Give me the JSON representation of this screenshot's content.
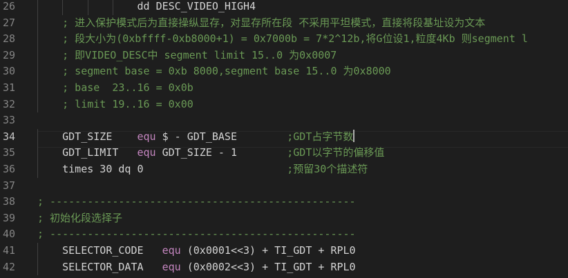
{
  "lines": [
    {
      "num": "26",
      "code": [
        {
          "t": "                dd DESC_VIDEO_HIGH4",
          "c": "plain"
        }
      ]
    },
    {
      "num": "27",
      "code": [
        {
          "t": "    ; 进入保护模式后为直接操纵显存，对显存所在段 不采用平坦模式，直接将段基址设为文本",
          "c": "cm"
        }
      ]
    },
    {
      "num": "28",
      "code": [
        {
          "t": "    ; 段大小为(0xbffff-0xb8000+1) = 0x7000b = 7*2^12b,将G位设1,粒度4Kb 则segment l",
          "c": "cm"
        }
      ]
    },
    {
      "num": "29",
      "code": [
        {
          "t": "    ; 即VIDEO_DESC中 segment limit 15..0 为0x0007",
          "c": "cm"
        }
      ]
    },
    {
      "num": "30",
      "code": [
        {
          "t": "    ; segment base = 0xb 8000,segment base 15..0 为0x8000",
          "c": "cm"
        }
      ]
    },
    {
      "num": "31",
      "code": [
        {
          "t": "    ; base  23..16 = 0x0b",
          "c": "cm"
        }
      ]
    },
    {
      "num": "32",
      "code": [
        {
          "t": "    ; limit 19..16 = 0x00",
          "c": "cm"
        }
      ]
    },
    {
      "num": "33",
      "code": [
        {
          "t": "",
          "c": "plain"
        }
      ]
    },
    {
      "num": "34",
      "code": [
        {
          "t": "    GDT_SIZE    ",
          "c": "plain"
        },
        {
          "t": "equ",
          "c": "kw"
        },
        {
          "t": " $ - GDT_BASE        ",
          "c": "plain"
        },
        {
          "t": ";GDT占字节数",
          "c": "cm"
        }
      ],
      "cursor": true,
      "active": true
    },
    {
      "num": "35",
      "code": [
        {
          "t": "    GDT_LIMIT   ",
          "c": "plain"
        },
        {
          "t": "equ",
          "c": "kw"
        },
        {
          "t": " GDT_SIZE - 1        ",
          "c": "plain"
        },
        {
          "t": ";GDT以字节的偏移值",
          "c": "cm"
        }
      ]
    },
    {
      "num": "36",
      "code": [
        {
          "t": "    times 30 dq 0                       ",
          "c": "plain"
        },
        {
          "t": ";预留30个描述符",
          "c": "cm"
        }
      ]
    },
    {
      "num": "37",
      "code": [
        {
          "t": "",
          "c": "plain"
        }
      ]
    },
    {
      "num": "38",
      "code": [
        {
          "t": "; -------------------------------------------------",
          "c": "cm"
        }
      ]
    },
    {
      "num": "39",
      "code": [
        {
          "t": "; 初始化段选择子",
          "c": "cm"
        }
      ]
    },
    {
      "num": "40",
      "code": [
        {
          "t": "; -------------------------------------------------",
          "c": "cm"
        }
      ]
    },
    {
      "num": "41",
      "code": [
        {
          "t": "    SELECTOR_CODE   ",
          "c": "plain"
        },
        {
          "t": "equ",
          "c": "kw"
        },
        {
          "t": " (0x0001<<3) + TI_GDT + RPL0",
          "c": "plain"
        }
      ]
    },
    {
      "num": "42",
      "code": [
        {
          "t": "    SELECTOR_DATA   ",
          "c": "plain"
        },
        {
          "t": "equ",
          "c": "kw"
        },
        {
          "t": " (0x0002<<3) + TI_GDT + RPL0",
          "c": "plain"
        }
      ]
    }
  ],
  "theme": {
    "background": "#1e1e1e",
    "line_number": "#858585",
    "comment": "#6a9955",
    "keyword": "#c586c0",
    "text": "#d4d4d4"
  }
}
